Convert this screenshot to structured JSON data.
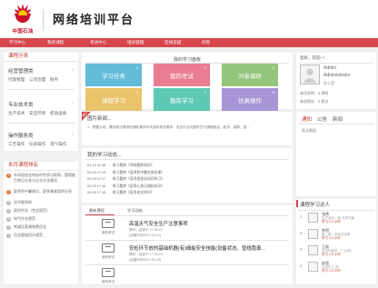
{
  "brand": {
    "logo_text": "中国石油",
    "title": "网络培训平台"
  },
  "nav": [
    "学习中心",
    "我的课程",
    "考试中心",
    "培训管理",
    "在线答疑",
    "问卷"
  ],
  "left": {
    "course_class_title": "课程分类",
    "sections": [
      {
        "title": "经营管理类",
        "sub": "行政管理　公司治理　财务"
      },
      {
        "title": "专业技术类",
        "sub": "生产技术　安全环保　机动设备"
      },
      {
        "title": "操作服务类",
        "sub": "工艺操作　仪表操作　电气操作"
      }
    ],
    "ranking_title": "本月课程排名",
    "ranking": [
      {
        "n": "1",
        "t": "车间班组长的标杆性质与职责，管理能力常见分享与企业文化建设"
      },
      {
        "n": "2",
        "t": "夏季防中暑知识，夏季事故案例分享"
      },
      {
        "n": "3",
        "t": "进不能到岗"
      },
      {
        "n": "4",
        "t": "高空作业（完全规范）"
      },
      {
        "n": "5",
        "t": "电气作业规范"
      },
      {
        "n": "6",
        "t": "常减压蒸馏装置优化"
      },
      {
        "n": "7",
        "t": "石化管道设计规范"
      }
    ]
  },
  "center": {
    "panel_title": "我的学习面板",
    "tiles": [
      {
        "label": "学习任务",
        "n": "4",
        "color": "#63bcd8"
      },
      {
        "label": "我的考试",
        "n": "0",
        "color": "#ea7d92"
      },
      {
        "label": "问卷调研",
        "n": "0",
        "color": "#93c57a"
      },
      {
        "label": "课程学习",
        "n": "0",
        "color": "#e9c46a"
      },
      {
        "label": "题库学习",
        "n": "0",
        "color": "#5ec9b5"
      },
      {
        "label": "仿真操作",
        "n": "0",
        "color": "#a895d6"
      }
    ],
    "notice_label": "通知",
    "news_title": "图片新闻...",
    "news_text": "1、根据公司、集团电汉要求的通知要求有关组织相关要求，安全行业问题学员与课程组合，如学，保障，做…",
    "dynamic_title": "我的学习动态...",
    "dynamics": [
      {
        "d": "04-10 11:48",
        "t": "练习题库《常规题库测试》"
      },
      {
        "d": "04-03 17:19",
        "t": "练习题库《夏季防中暑应急处理》"
      },
      {
        "d": "04-03 17:17",
        "t": "练习题库《夏季班组长知识练习》"
      },
      {
        "d": "04-03 17:16",
        "t": "练习题库《夏季心急压缩机知识》"
      },
      {
        "d": "04-03 17:15",
        "t": "练习题库《夏季安全知识》"
      }
    ],
    "exam_tabs": [
      "最新课程",
      "学习动态"
    ],
    "exams": [
      {
        "cap": "我的考试",
        "t": "高温天气安全生产注意事项",
        "s": "限时：结束于 17-06-07",
        "c": "(创建时间2017-06-01)"
      },
      {
        "cap": "我的考试",
        "t": "安检环节放的基础机器(有)细能安全技能(设备状态、管线隐患...",
        "s": "限时：结束于 17-05-24",
        "c": "(创建时间2017-05-18)"
      },
      {
        "cap": "我的考试",
        "t": "",
        "s": "",
        "c": ""
      }
    ]
  },
  "right": {
    "greeting": "您好，欢迎~！",
    "user": {
      "name": "Admin",
      "role": "Administrator",
      "dept": "办公室",
      "hours": "本月学时：0 学时",
      "score": "本次积分：0 积分"
    },
    "tabs": [
      "通知",
      "公告",
      "新闻"
    ],
    "empty": "暂无数据",
    "rank_title": "课程学习达人",
    "learners": [
      {
        "nm": "张德",
        "ds": "生产运行一部 天然气部",
        "sc": "学习 2.2 小时"
      },
      {
        "nm": "李明",
        "ds": "第二部，炼化石油室",
        "sc": "学习 2.0 小时"
      },
      {
        "nm": "王刚",
        "ds": "安全环保处（二公司）",
        "sc": "学习 1.5 小时"
      },
      {
        "nm": "赵强",
        "ds": "石油化工 部",
        "sc": "学习 1.2 小时"
      }
    ]
  }
}
